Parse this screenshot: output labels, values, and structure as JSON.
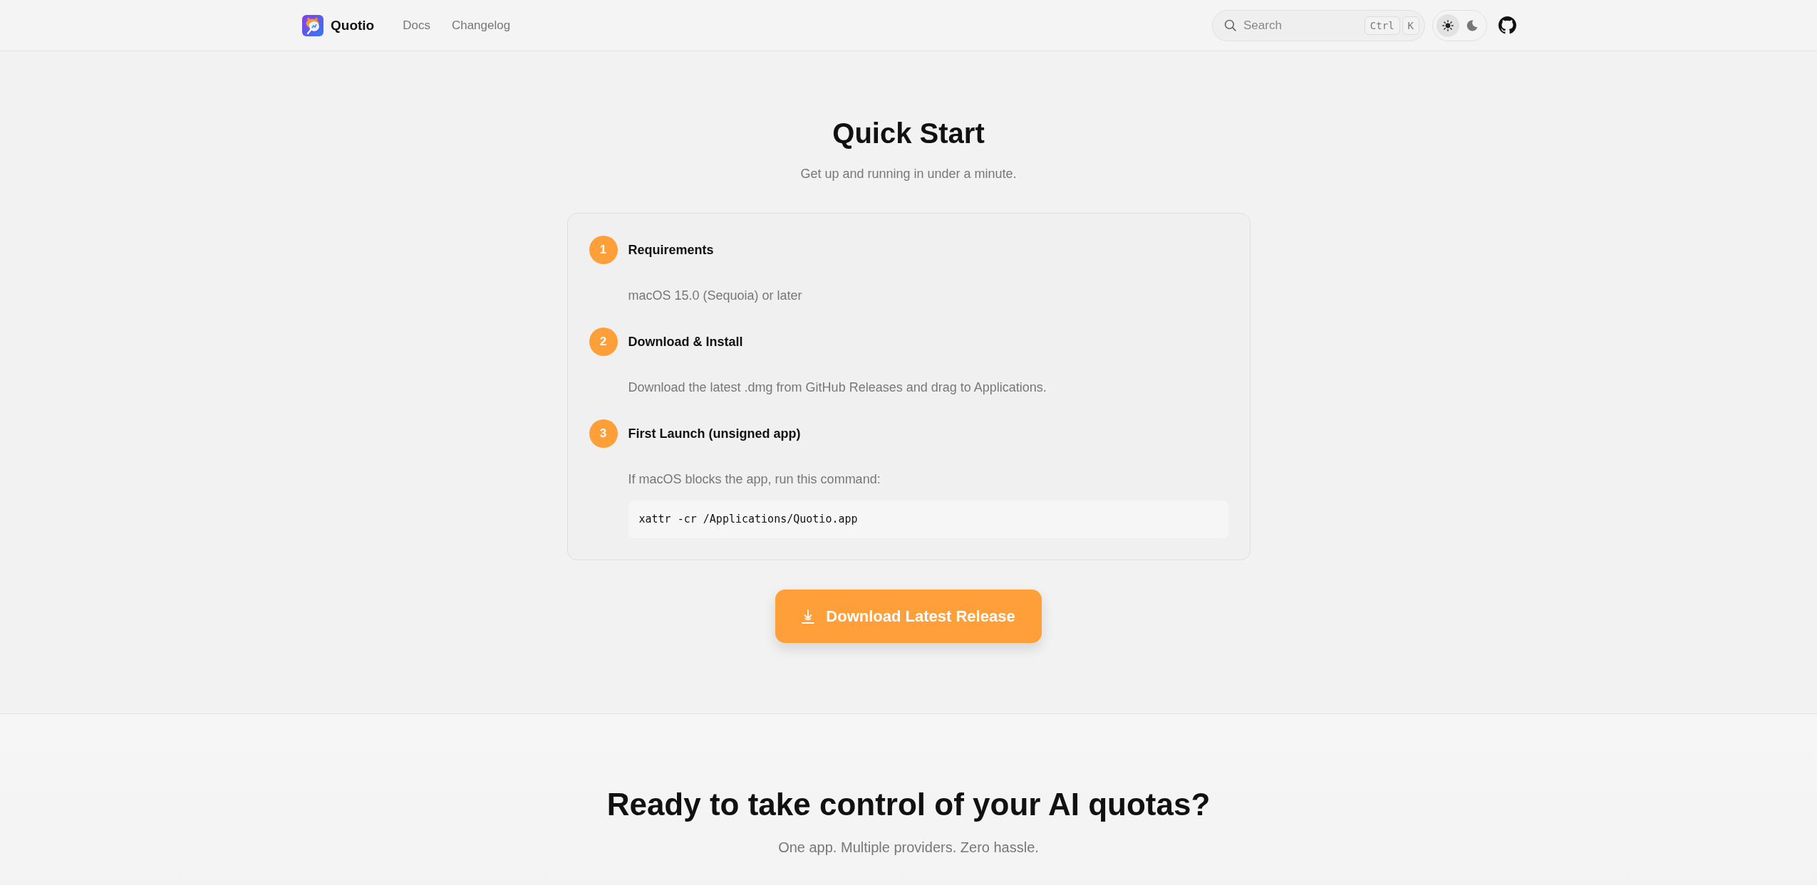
{
  "header": {
    "logo": {
      "name": "Quotio"
    },
    "nav": [
      {
        "label": "Docs"
      },
      {
        "label": "Changelog"
      }
    ],
    "search": {
      "placeholder": "Search",
      "shortcut": [
        "Ctrl",
        "K"
      ]
    },
    "theme_toggle": [
      {
        "kind": "light",
        "selected": true
      },
      {
        "kind": "dark",
        "selected": false
      }
    ]
  },
  "quick_start": {
    "title": "Quick Start",
    "subtitle": "Get up and running in under a minute.",
    "steps": [
      {
        "number": "1",
        "title": "Requirements",
        "description": "macOS 15.0 (Sequoia) or later"
      },
      {
        "number": "2",
        "title": "Download & Install",
        "description": "Download the latest .dmg from GitHub Releases and drag to Applications."
      },
      {
        "number": "3",
        "title": "First Launch (unsigned app)",
        "description": "If macOS blocks the app, run this command:",
        "code": "xattr -cr /Applications/Quotio.app"
      }
    ],
    "download_button": "Download Latest Release"
  },
  "cta": {
    "title": "Ready to take control of your AI quotas?",
    "subtitle": "One app. Multiple providers. Zero hassle."
  }
}
